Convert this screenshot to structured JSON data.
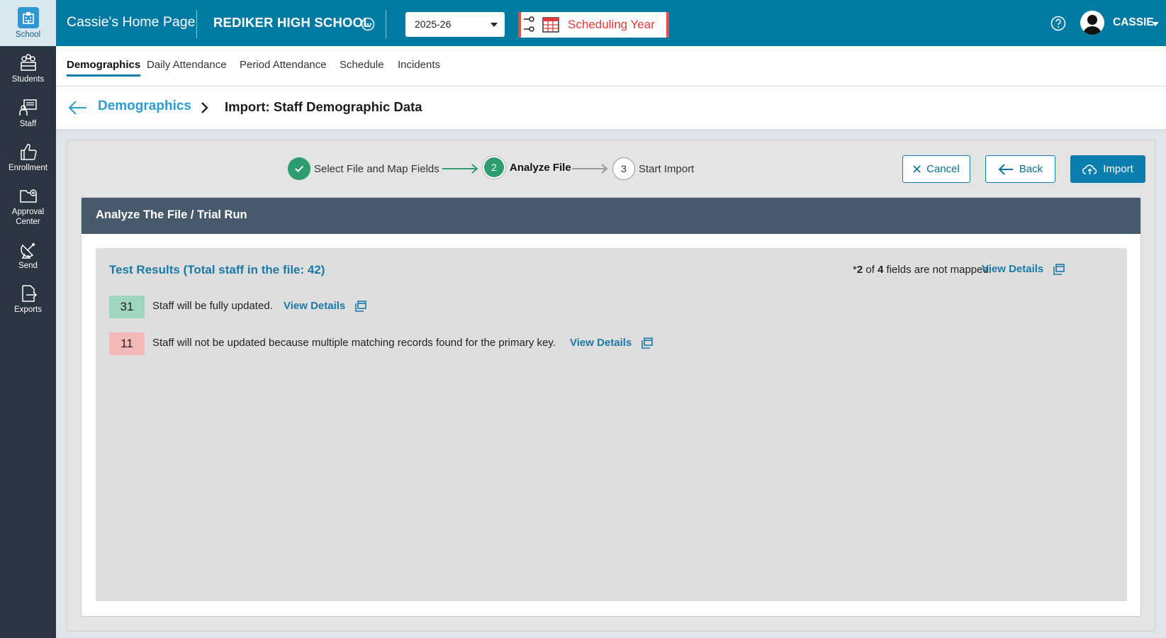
{
  "sidebar": {
    "items": [
      {
        "label": "School",
        "icon": "school-icon"
      },
      {
        "label": "Students",
        "icon": "students-icon"
      },
      {
        "label": "Staff",
        "icon": "staff-icon"
      },
      {
        "label": "Enrollment",
        "icon": "thumbs-up-icon"
      },
      {
        "label_line1": "Approval",
        "label_line2": "Center",
        "icon": "folder-icon"
      },
      {
        "label": "Send",
        "icon": "satellite-dish-icon"
      },
      {
        "label": "Exports",
        "icon": "export-file-icon"
      }
    ]
  },
  "header": {
    "home_title": "Cassie's Home Page",
    "school_name": "REDIKER HIGH SCHOOL",
    "year": "2025-26",
    "scheduling_badge": "Scheduling Year",
    "user_name": "CASSIE"
  },
  "tabs": [
    {
      "label": "Demographics",
      "active": true
    },
    {
      "label": "Daily Attendance"
    },
    {
      "label": "Period Attendance"
    },
    {
      "label": "Schedule"
    },
    {
      "label": "Incidents"
    }
  ],
  "breadcrumb": {
    "parent": "Demographics",
    "current": "Import: Staff Demographic Data"
  },
  "stepper": {
    "steps": [
      {
        "number": "",
        "label": "Select File and Map Fields",
        "state": "done"
      },
      {
        "number": "2",
        "label": "Analyze File",
        "state": "current"
      },
      {
        "number": "3",
        "label": "Start Import",
        "state": "pending"
      }
    ]
  },
  "actions": {
    "cancel": "Cancel",
    "back": "Back",
    "import": "Import"
  },
  "card": {
    "title": "Analyze The File / Trial Run",
    "results_title": "Test Results (Total staff in the file: 42)",
    "not_mapped_prefix": "*",
    "not_mapped_count": "2",
    "not_mapped_of": " of ",
    "not_mapped_total": "4",
    "not_mapped_suffix": " fields are not mapped.",
    "view_details": "View Details",
    "rows": [
      {
        "count": "31",
        "text": "Staff will be fully updated.",
        "link": "View Details"
      },
      {
        "count": "11",
        "text": "Staff will not be updated because multiple matching records found for the primary key.",
        "link": "View Details"
      }
    ]
  },
  "colors": {
    "header_bg": "#007aa3",
    "sidebar_bg": "#2b3441",
    "accent": "#0a7fae",
    "success": "#2d9c6f",
    "badge_updated": "#9ed6bb",
    "badge_not_updated": "#f4b8b8",
    "scheduling_red": "#e03a3a"
  }
}
